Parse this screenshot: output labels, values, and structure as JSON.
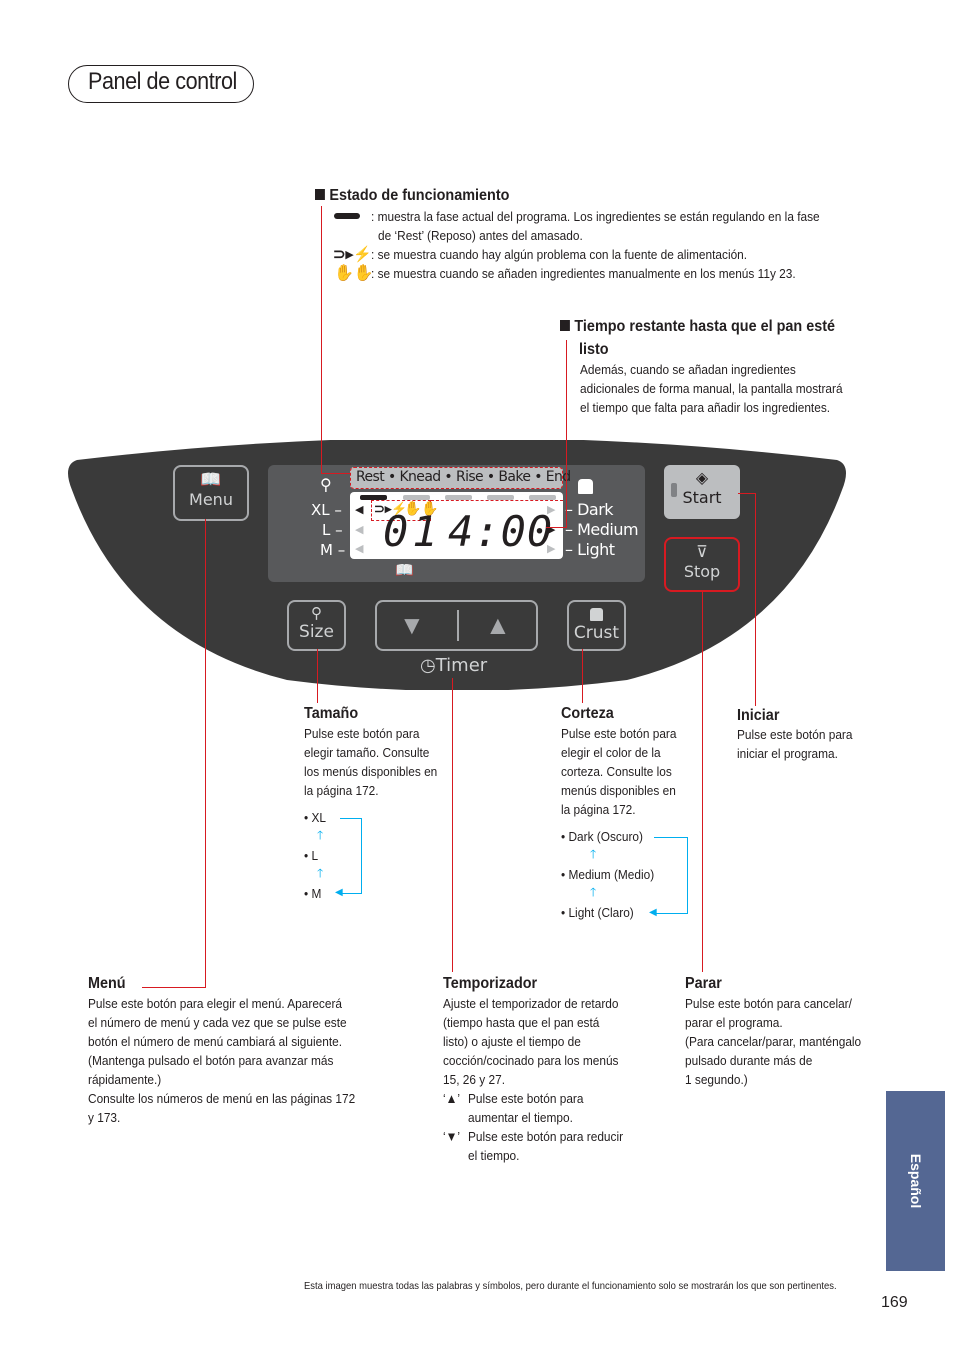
{
  "page_title": "Panel de control",
  "estado": {
    "heading": "Estado de funcionamiento",
    "items": [
      {
        "icon": "phase-bar-icon",
        "text_1": ": muestra la fase actual del programa. Los ingredientes se están regulando en la fase",
        "text_2": "de ‘Rest’ (Reposo) antes del amasado."
      },
      {
        "icon": "power-plug-icon",
        "text_1": ": se muestra cuando hay algún problema con la fuente de alimentación."
      },
      {
        "icon": "hands-icon",
        "text_1": ": se muestra cuando se añaden ingredientes manualmente en los menús 11y 23."
      }
    ]
  },
  "tiempo": {
    "heading_1": "Tiempo restante hasta que el pan esté",
    "heading_2": "listo",
    "lines": [
      "Además, cuando se añadan ingredientes",
      "adicionales de forma manual, la pantalla mostrará",
      "el tiempo que falta para añadir los ingredientes."
    ]
  },
  "panel": {
    "menu_label": "Menu",
    "size_label": "Size",
    "crust_label": "Crust",
    "start_label": "Start",
    "stop_label": "Stop",
    "timer_label": "Timer",
    "down_arrow": "▼",
    "up_arrow": "▲",
    "lcd": {
      "phases": "Rest • Knead • Rise • Bake • End",
      "active_phase": "Rest",
      "sizes": [
        "XL –",
        "L –",
        "M –"
      ],
      "crusts": [
        "– Dark",
        "– Medium",
        "– Light"
      ],
      "menu_number": "01",
      "time": "4:00",
      "selected_size": "XL",
      "selected_crust": "Medium"
    }
  },
  "tamano": {
    "heading": "Tamaño",
    "lines": [
      "Pulse este botón para",
      "elegir tamaño. Consulte",
      "los menús disponibles en",
      "la página 172."
    ],
    "options": [
      "• XL",
      "• L",
      "• M"
    ]
  },
  "corteza": {
    "heading": "Corteza",
    "lines": [
      "Pulse este botón para",
      "elegir el color de la",
      "corteza. Consulte los",
      "menús disponibles en",
      "la página 172."
    ],
    "options": [
      "• Dark (Oscuro)",
      "• Medium (Medio)",
      "• Light (Claro)"
    ]
  },
  "iniciar": {
    "heading": "Iniciar",
    "lines": [
      "Pulse este botón para",
      "iniciar el programa."
    ]
  },
  "menu_desc": {
    "heading": "Menú",
    "lines": [
      "Pulse este botón para elegir el menú. Aparecerá",
      "el número de menú y cada vez que se pulse este",
      "botón el número de menú cambiará al siguiente.",
      "(Mantenga pulsado el botón para avanzar más",
      "rápidamente.)",
      "Consulte los números de menú en las páginas 172",
      "y 173."
    ]
  },
  "temporizador": {
    "heading": "Temporizador",
    "lines": [
      "Ajuste el temporizador de retardo",
      "(tiempo hasta que el pan está",
      "listo) o ajuste el tiempo de",
      "cocción/cocinado para los menús",
      "15, 26 y 27."
    ],
    "up_note_key": "‘▲’",
    "up_note_1": "Pulse este botón para",
    "up_note_2": "aumentar el tiempo.",
    "down_note_key": "‘▼’",
    "down_note_1": "Pulse este botón para reducir",
    "down_note_2": "el tiempo."
  },
  "parar": {
    "heading": "Parar",
    "lines": [
      "Pulse este botón para cancelar/",
      "parar el programa.",
      "(Para cancelar/parar, manténgalo",
      "pulsado durante más de",
      "1 segundo.)"
    ]
  },
  "side_tab": "Español",
  "footer_note": "Esta imagen muestra todas las palabras y símbolos, pero durante el funcionamiento solo se mostrarán los que son pertinentes.",
  "page_number": "169",
  "colors": {
    "leader_red": "#d71a21",
    "arrow_blue": "#00aeef",
    "panel_dark": "#3a3a3a",
    "tab_blue": "#546793"
  }
}
